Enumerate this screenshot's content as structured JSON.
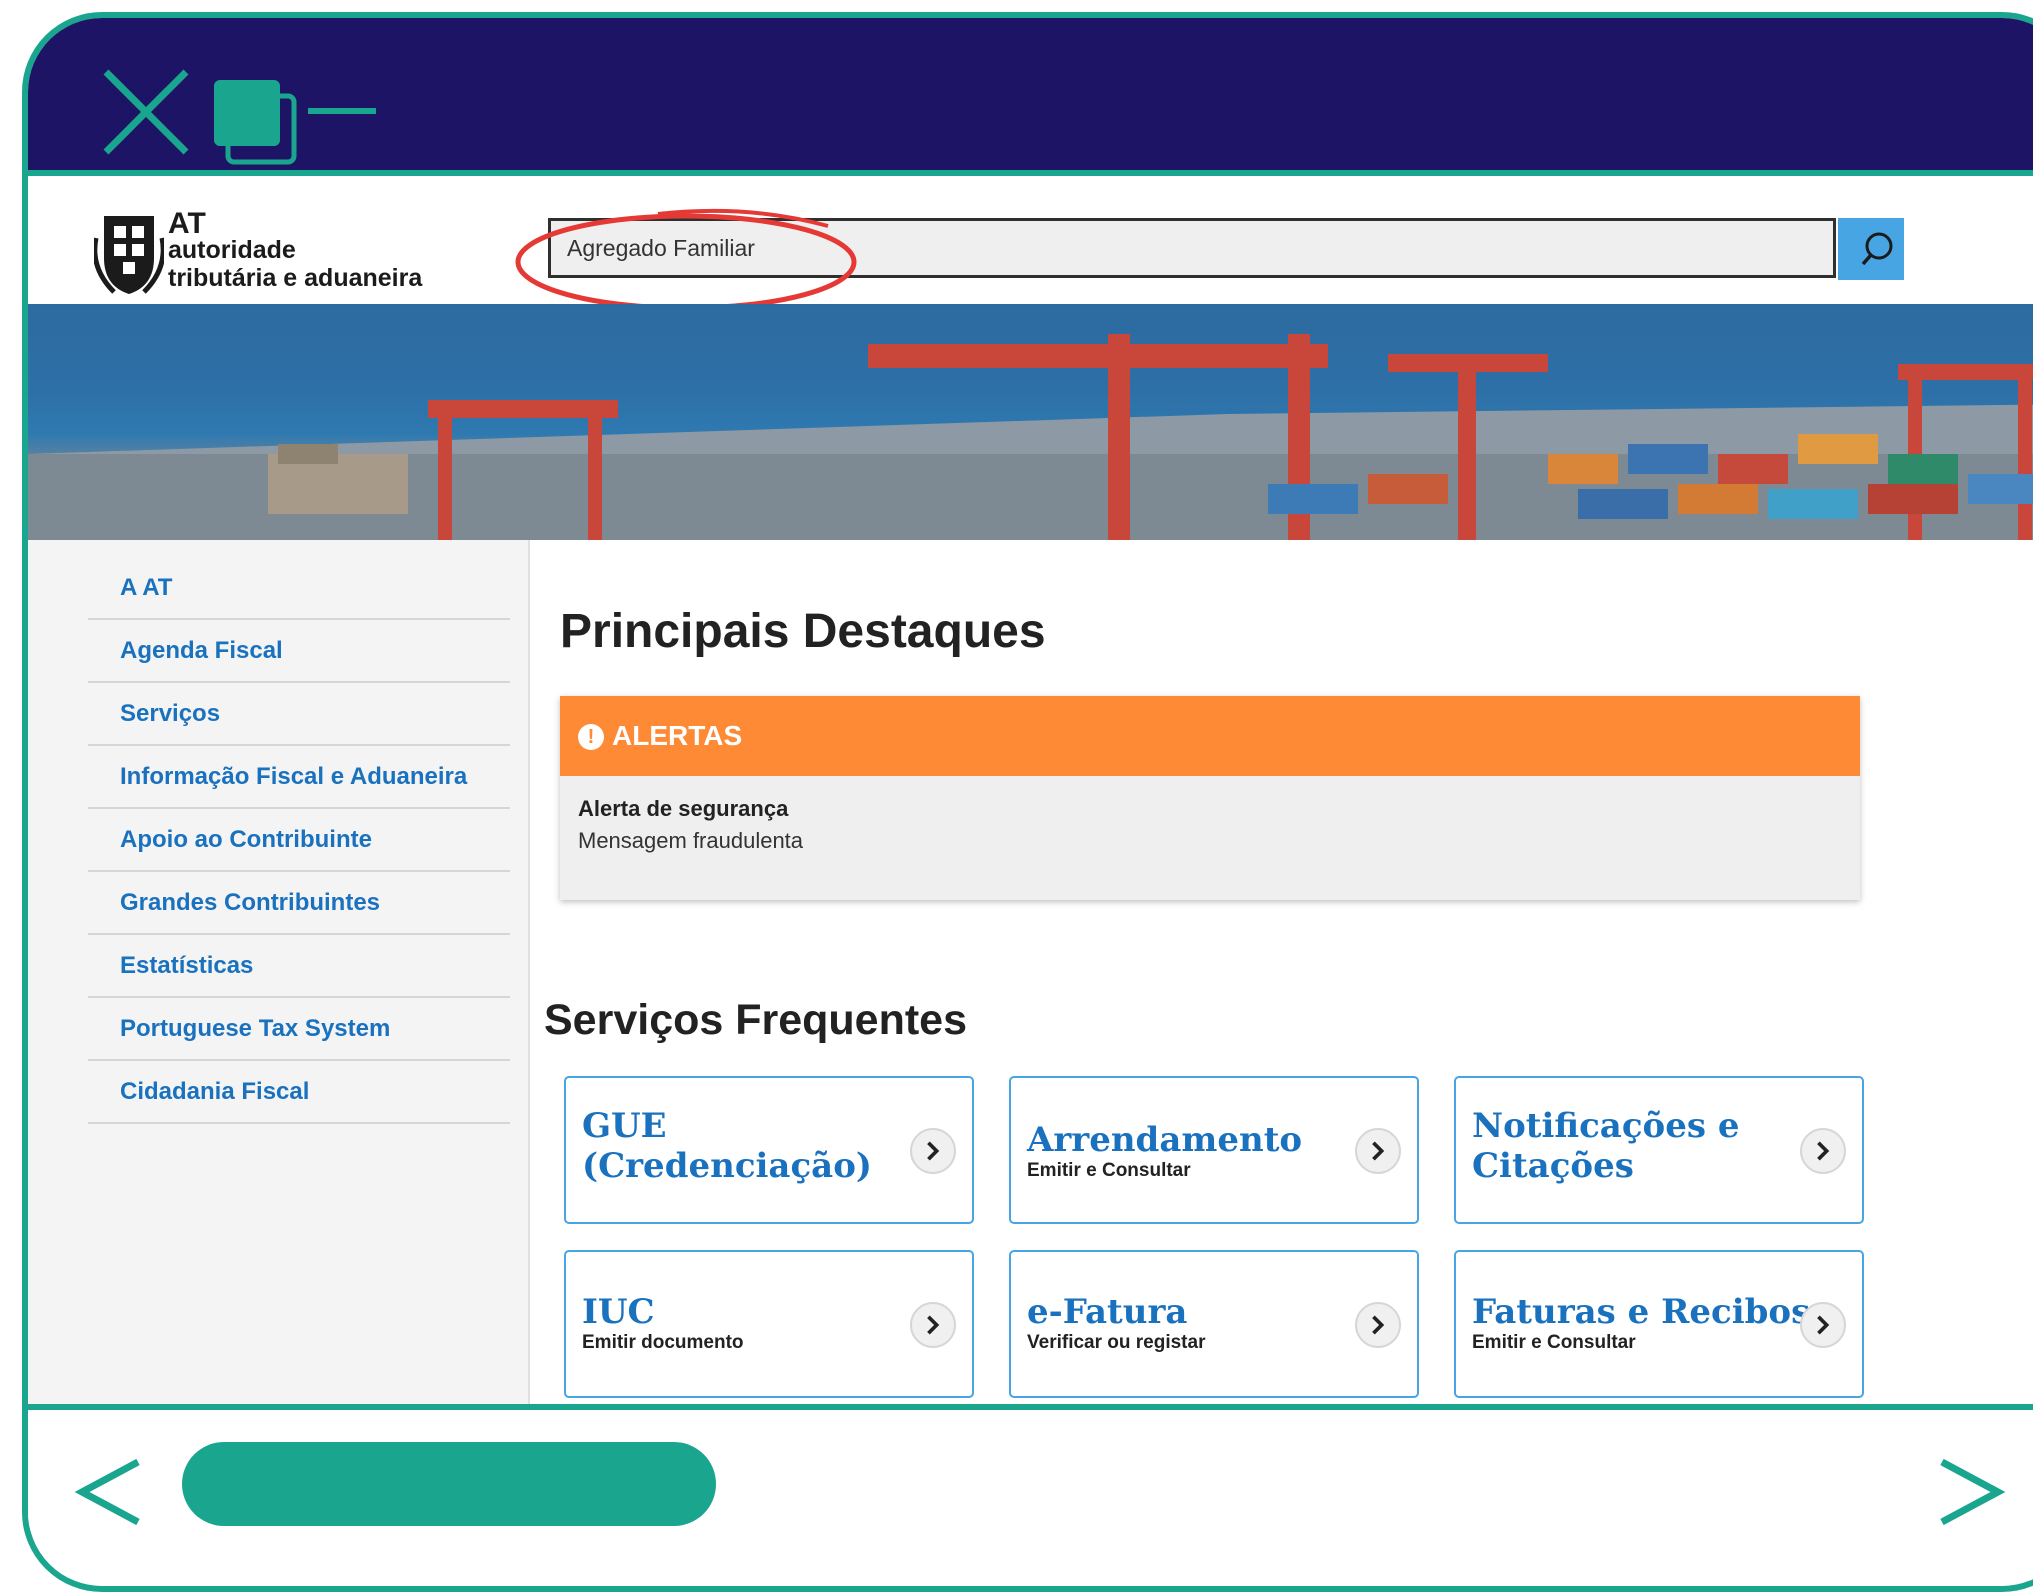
{
  "header": {
    "logo_short": "AT",
    "logo_line1": "autoridade",
    "logo_line2": "tributária e aduaneira",
    "search_value": "Agregado Familiar"
  },
  "sidebar": {
    "items": [
      {
        "label": "A AT"
      },
      {
        "label": "Agenda Fiscal"
      },
      {
        "label": "Serviços"
      },
      {
        "label": "Informação Fiscal e Aduaneira"
      },
      {
        "label": "Apoio ao Contribuinte"
      },
      {
        "label": "Grandes Contribuintes"
      },
      {
        "label": "Estatísticas"
      },
      {
        "label": "Portuguese Tax System"
      },
      {
        "label": "Cidadania Fiscal"
      }
    ]
  },
  "main": {
    "title": "Principais Destaques",
    "alert": {
      "label": "ALERTAS",
      "title": "Alerta de segurança",
      "message": "Mensagem fraudulenta"
    },
    "services_title": "Serviços Frequentes",
    "cards": [
      {
        "title": "GUE (Credenciação)",
        "subtitle": ""
      },
      {
        "title": "Arrendamento",
        "subtitle": "Emitir e Consultar"
      },
      {
        "title": "Notificações e Citações",
        "subtitle": ""
      },
      {
        "title": "IUC",
        "subtitle": "Emitir documento"
      },
      {
        "title": "e-Fatura",
        "subtitle": "Verificar ou registar"
      },
      {
        "title": "Faturas e Recibos",
        "subtitle": "Emitir e Consultar"
      }
    ]
  },
  "colors": {
    "frame_accent": "#1aa68e",
    "titlebar": "#1e1466",
    "link_blue": "#1a72bf",
    "alert_orange": "#ff8a35",
    "search_button": "#47a5e3",
    "annotation_red": "#e53935"
  },
  "icons": [
    "close-icon",
    "restore-icon",
    "minimize-icon",
    "search-icon",
    "alert-icon",
    "chevron-right-icon",
    "back-arrow-icon",
    "forward-arrow-icon"
  ]
}
